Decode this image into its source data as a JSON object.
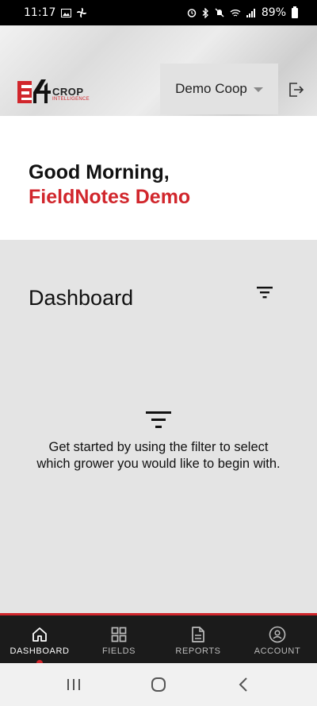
{
  "status_bar": {
    "time": "11:17",
    "battery": "89%"
  },
  "header": {
    "logo": {
      "mark": "E4",
      "crop": "CROP",
      "intelligence": "INTELLIGENCE"
    },
    "coop_select": {
      "value": "Demo Coop"
    },
    "logout_icon": "logout-icon"
  },
  "greeting": {
    "line": "Good Morning,",
    "name": "FieldNotes Demo"
  },
  "dashboard": {
    "title": "Dashboard",
    "empty_message": "Get started by using the filter to select which grower you would like to begin with."
  },
  "bottom_nav": {
    "items": [
      {
        "label": "DASHBOARD",
        "icon": "home-icon",
        "active": true
      },
      {
        "label": "FIELDS",
        "icon": "grid-icon",
        "active": false
      },
      {
        "label": "REPORTS",
        "icon": "document-icon",
        "active": false
      },
      {
        "label": "ACCOUNT",
        "icon": "account-icon",
        "active": false
      }
    ]
  },
  "colors": {
    "accent": "#d1262c",
    "nav_bg": "#1b1b1b",
    "dashboard_bg": "#e4e4e4"
  }
}
